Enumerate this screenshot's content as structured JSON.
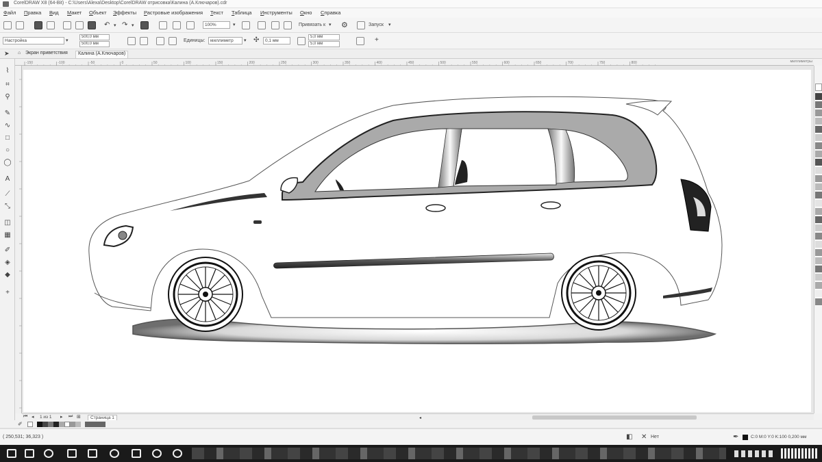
{
  "window": {
    "title": "CorelDRAW X8 (64-Bit) - C:\\Users\\Alexa\\Desktop\\CorelDRAW отрисовка\\Калина (А.Ключаров).cdr"
  },
  "menu": {
    "items": [
      "Файл",
      "Правка",
      "Вид",
      "Макет",
      "Объект",
      "Эффекты",
      "Растровые изображения",
      "Текст",
      "Таблица",
      "Инструменты",
      "Окно",
      "Справка"
    ]
  },
  "toolbar": {
    "zoom_value": "100%",
    "snap_label": "Привязать к",
    "launch_label": "Запуск"
  },
  "property_bar": {
    "preset_value": "Настройка",
    "width_value": "500,0 мм",
    "height_value": "500,0 мм",
    "units_label": "Единицы:",
    "units_value": "миллиметр",
    "nudge_value": "0,1 мм",
    "dup_x_value": "5,0 мм",
    "dup_y_value": "5,0 мм"
  },
  "doc_tabs": [
    "Экран приветствия",
    "Калина (А.Ключаров)"
  ],
  "ruler": {
    "ticks": [
      "-150",
      "-100",
      "-50",
      "0",
      "50",
      "100",
      "150",
      "200",
      "250",
      "300",
      "350",
      "400",
      "450",
      "500",
      "550",
      "600",
      "650",
      "700",
      "750",
      "800"
    ],
    "unit": "миллиметры"
  },
  "page_nav": {
    "counter": "1 из 1",
    "page_tab": "Страница 1"
  },
  "status": {
    "coordinates": "( 250,531; 36,323 )",
    "fill_none": "Нет",
    "outline": "C:0 M:0 Y:0 K:100  0,200 мм"
  },
  "colors": {
    "chrome": "#f4f4f4",
    "page": "#ffffff",
    "canvas": "#e6e6e6",
    "taskbar": "#1a1a1a"
  },
  "icons": [
    "pick-tool-icon",
    "shape-tool-icon",
    "crop-tool-icon",
    "zoom-tool-icon",
    "freehand-tool-icon",
    "artistic-media-icon",
    "rectangle-tool-icon",
    "ellipse-tool-icon",
    "polygon-tool-icon",
    "text-tool-icon",
    "parallel-dimension-icon",
    "connector-tool-icon",
    "drop-shadow-icon",
    "transparency-icon",
    "eyedropper-icon",
    "interactive-fill-icon",
    "smart-fill-icon",
    "add-tool-icon"
  ]
}
